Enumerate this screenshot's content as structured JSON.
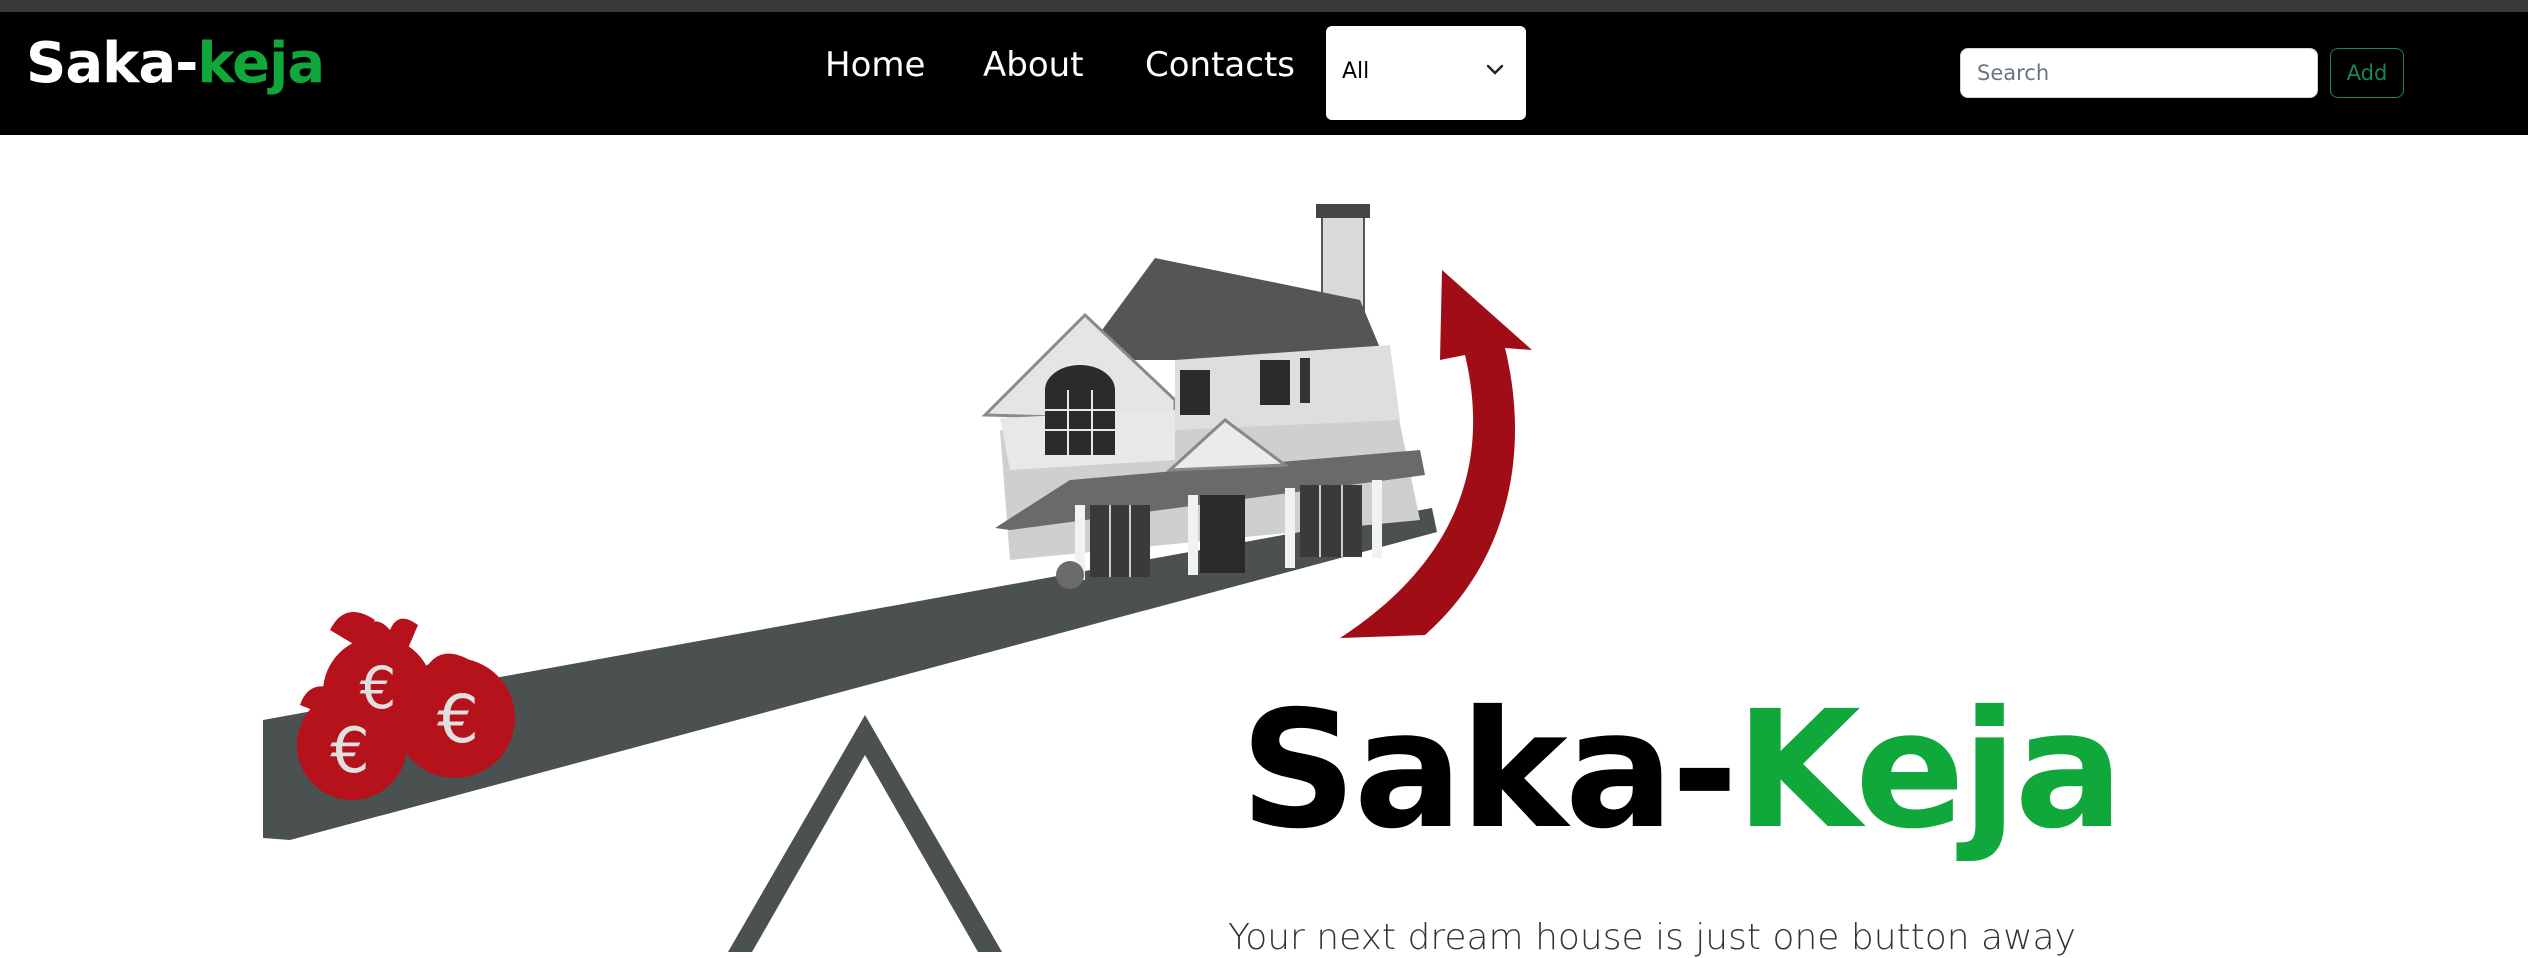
{
  "brand": {
    "part1": "Saka-",
    "part2": "keja"
  },
  "nav": {
    "home": "Home",
    "about": "About",
    "contacts": "Contacts"
  },
  "filter": {
    "selected": "All"
  },
  "search": {
    "placeholder": "Search",
    "value": ""
  },
  "actions": {
    "add_label": "Add"
  },
  "hero": {
    "title_part1": "Saka-",
    "title_part2": "Keja",
    "tagline": "Your next dream house is just one button away"
  },
  "icons": [
    "chevron-down-icon",
    "euro-money-bag-icon",
    "house-icon",
    "arrow-up-icon",
    "seesaw-icon"
  ],
  "colors": {
    "navbar": "#000000",
    "accent": "#11a83b",
    "outline_button": "#198754",
    "money_red": "#b5121b"
  }
}
